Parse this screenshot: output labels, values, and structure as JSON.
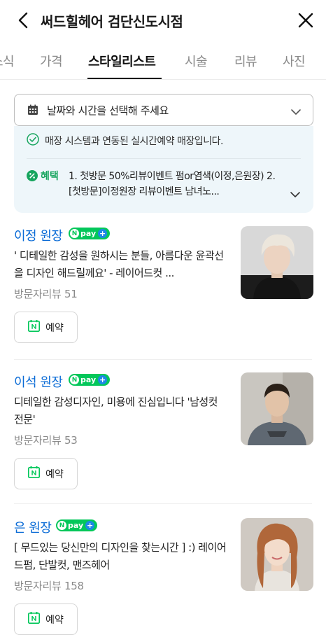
{
  "header": {
    "title": "써드힐헤어 검단신도시점"
  },
  "tabs": [
    {
      "label": "소식"
    },
    {
      "label": "가격"
    },
    {
      "label": "스타일리스트",
      "active": true
    },
    {
      "label": "시술"
    },
    {
      "label": "리뷰"
    },
    {
      "label": "사진"
    }
  ],
  "date_select": {
    "placeholder": "날짜와 시간을 선택해 주세요"
  },
  "info": {
    "realtime_text": "매장 시스템과 연동된 실시간예약 매장입니다.",
    "benefit_label": "혜택",
    "benefit_text": "1. 첫방문 50%리뷰이벤트 펌or염색(이정,은원장) 2. [첫방문]이정원장 리뷰이벤트 남녀노..."
  },
  "npay_label": "pay",
  "designers": [
    {
      "name": "이정 원장",
      "description": "' 디테일한 감성을 원하시는 분들, 아름다운 윤곽선을 디자인 해드릴께요' - 레이어드컷 ...",
      "reviews": "방문자리뷰 51",
      "reserve_label": "예약"
    },
    {
      "name": "이석 원장",
      "description": "디테일한 감성디자인, 미용에 진심입니다 '남성컷 전문'",
      "reviews": "방문자리뷰 53",
      "reserve_label": "예약"
    },
    {
      "name": "은 원장",
      "description": "[ 무드있는 당신만의 디자인을 찾는시간 ] :) 레이어드펌, 단발컷, 맨즈헤어",
      "reviews": "방문자리뷰 158",
      "reserve_label": "예약"
    }
  ],
  "colors": {
    "accent_blue": "#0a6bd6",
    "naver_green": "#03c75a",
    "info_bg": "#eef6fa"
  }
}
